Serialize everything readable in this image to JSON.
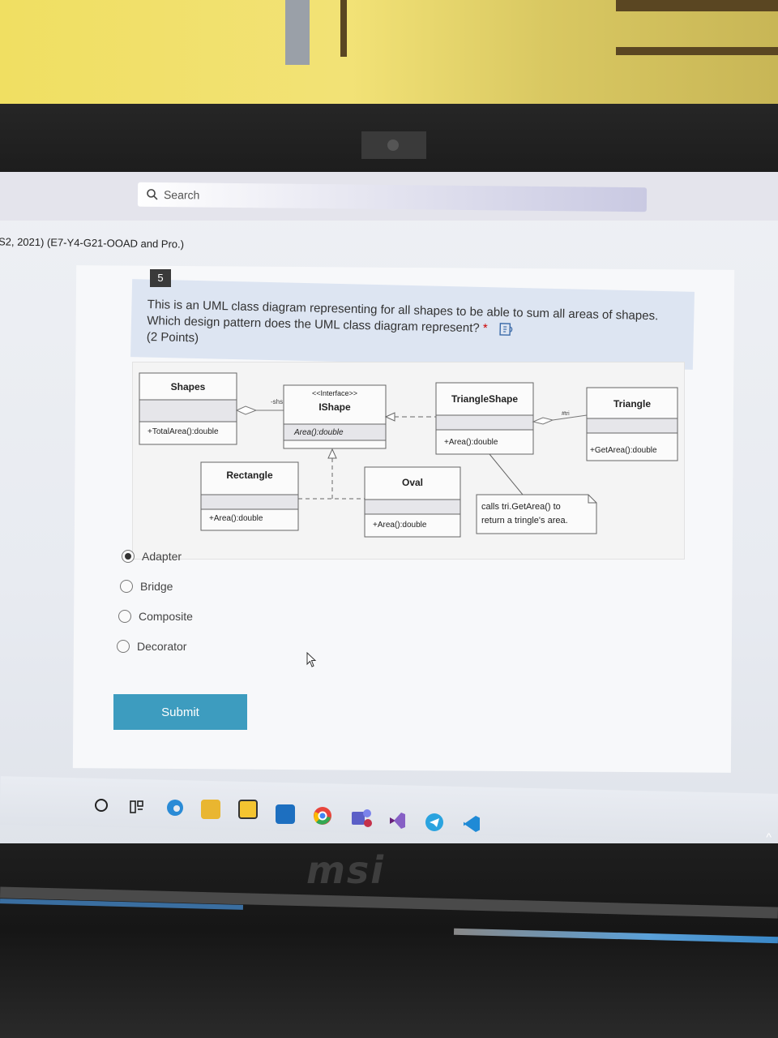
{
  "search": {
    "placeholder": "Search"
  },
  "form": {
    "title": "S2, 2021) (E7-Y4-G21-OOAD and Pro.)"
  },
  "question": {
    "number": "5",
    "line1": "This is an UML class diagram representing for all shapes to be able to sum all areas of shapes.",
    "line2": "Which design pattern does the UML class diagram represent?",
    "required_mark": "*",
    "points": "(2 Points)"
  },
  "diagram": {
    "shapes": {
      "name": "Shapes",
      "method": "+TotalArea():double"
    },
    "ishape": {
      "stereotype": "<<Interface>>",
      "name": "IShape",
      "method": "Area():double"
    },
    "rectangle": {
      "name": "Rectangle",
      "method": "+Area():double"
    },
    "oval": {
      "name": "Oval",
      "method": "+Area():double"
    },
    "triangle_shape": {
      "name": "TriangleShape",
      "method": "+Area():double"
    },
    "triangle": {
      "name": "Triangle",
      "method": "+GetArea():double"
    },
    "role_shs": "-shs",
    "role_tri": "#tri",
    "note_line1": "calls tri.GetArea() to",
    "note_line2": "return a tringle's area."
  },
  "options": [
    {
      "label": "Adapter",
      "selected": true
    },
    {
      "label": "Bridge",
      "selected": false
    },
    {
      "label": "Composite",
      "selected": false
    },
    {
      "label": "Decorator",
      "selected": false
    }
  ],
  "submit_label": "Submit",
  "taskbar_icons": [
    "search-circle-icon",
    "task-view-icon",
    "edge-icon",
    "file-explorer-icon",
    "store-icon",
    "mail-icon",
    "chrome-icon",
    "teams-icon",
    "visual-studio-icon",
    "telegram-icon",
    "vscode-icon"
  ],
  "brand": "msi",
  "colors": {
    "submit": "#3d9cbf",
    "question_header": "#dde5f2"
  }
}
